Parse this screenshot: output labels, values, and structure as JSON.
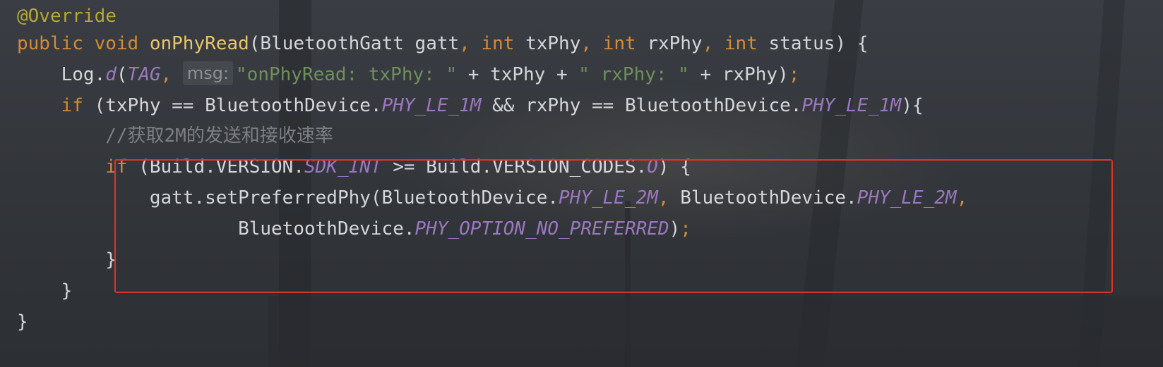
{
  "editor": {
    "lines": [
      {
        "id": "l1",
        "tokens": [
          {
            "cls": "ann",
            "text": "@Override"
          }
        ]
      },
      {
        "id": "l2",
        "tokens": [
          {
            "cls": "kw",
            "text": "public void "
          },
          {
            "cls": "fn",
            "text": "onPhyRead"
          },
          {
            "cls": "",
            "text": "(BluetoothGatt gatt"
          },
          {
            "cls": "punc",
            "text": ", "
          },
          {
            "cls": "kw",
            "text": "int "
          },
          {
            "cls": "",
            "text": "txPhy"
          },
          {
            "cls": "punc",
            "text": ", "
          },
          {
            "cls": "kw",
            "text": "int "
          },
          {
            "cls": "",
            "text": "rxPhy"
          },
          {
            "cls": "punc",
            "text": ", "
          },
          {
            "cls": "kw",
            "text": "int "
          },
          {
            "cls": "",
            "text": "status) {"
          }
        ]
      },
      {
        "id": "l3",
        "tokens": [
          {
            "cls": "",
            "text": "    Log."
          },
          {
            "cls": "const",
            "text": "d"
          },
          {
            "cls": "",
            "text": "("
          },
          {
            "cls": "const",
            "text": "TAG"
          },
          {
            "cls": "punc",
            "text": ", "
          },
          {
            "cls": "hint",
            "text": "msg:"
          },
          {
            "cls": "str",
            "text": "\"onPhyRead: txPhy: \""
          },
          {
            "cls": "",
            "text": " + txPhy + "
          },
          {
            "cls": "str",
            "text": "\" rxPhy: \""
          },
          {
            "cls": "",
            "text": " + rxPhy)"
          },
          {
            "cls": "punc",
            "text": ";"
          }
        ]
      },
      {
        "id": "l4",
        "tokens": [
          {
            "cls": "kw",
            "text": "    if "
          },
          {
            "cls": "",
            "text": "(txPhy == BluetoothDevice."
          },
          {
            "cls": "const",
            "text": "PHY_LE_1M"
          },
          {
            "cls": "",
            "text": " && rxPhy == BluetoothDevice."
          },
          {
            "cls": "const",
            "text": "PHY_LE_1M"
          },
          {
            "cls": "",
            "text": "){"
          }
        ]
      },
      {
        "id": "l5",
        "tokens": [
          {
            "cls": "cmt",
            "text": "        //获取2M的发送和接收速率"
          }
        ]
      },
      {
        "id": "l6",
        "tokens": [
          {
            "cls": "kw",
            "text": "        if "
          },
          {
            "cls": "",
            "text": "(Build.VERSION."
          },
          {
            "cls": "const",
            "text": "SDK_INT"
          },
          {
            "cls": "",
            "text": " >= Build.VERSION_CODES."
          },
          {
            "cls": "const",
            "text": "O"
          },
          {
            "cls": "",
            "text": ") {"
          }
        ]
      },
      {
        "id": "l7",
        "tokens": [
          {
            "cls": "",
            "text": "            gatt.setPreferredPhy(BluetoothDevice."
          },
          {
            "cls": "const",
            "text": "PHY_LE_2M"
          },
          {
            "cls": "punc",
            "text": ", "
          },
          {
            "cls": "",
            "text": "BluetoothDevice."
          },
          {
            "cls": "const",
            "text": "PHY_LE_2M"
          },
          {
            "cls": "punc",
            "text": ","
          }
        ]
      },
      {
        "id": "l8",
        "tokens": [
          {
            "cls": "",
            "text": "                    BluetoothDevice."
          },
          {
            "cls": "const",
            "text": "PHY_OPTION_NO_PREFERRED"
          },
          {
            "cls": "",
            "text": ")"
          },
          {
            "cls": "punc",
            "text": ";"
          }
        ]
      },
      {
        "id": "l9",
        "tokens": [
          {
            "cls": "",
            "text": "        }"
          }
        ]
      },
      {
        "id": "l10",
        "tokens": [
          {
            "cls": "",
            "text": "    }"
          }
        ]
      },
      {
        "id": "l11",
        "tokens": [
          {
            "cls": "",
            "text": "}"
          }
        ]
      }
    ]
  },
  "highlight": {
    "color": "#d9352c"
  },
  "colors": {
    "keyword": "#d08c3a",
    "annotation": "#b3a935",
    "method": "#e8c56a",
    "constant": "#9a78be",
    "string": "#6f8f5c",
    "comment": "#7d7f85",
    "text": "#d4d6da"
  }
}
